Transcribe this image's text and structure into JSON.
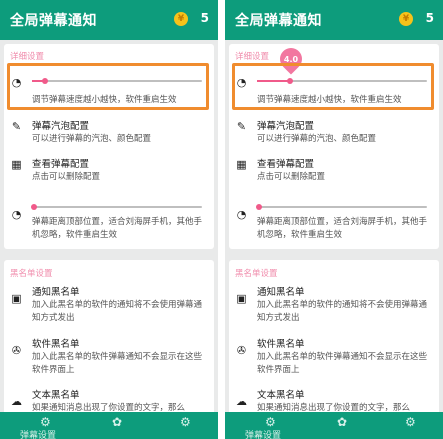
{
  "left": {
    "title": "全局弹幕通知",
    "coin_count": "5",
    "section_detail": "详细设置",
    "speed_desc": "调节弹幕速度越小越快，软件重启生效",
    "bubble_title": "弹幕汽泡配置",
    "bubble_desc": "可以进行弹幕的汽泡、颜色配置",
    "view_title": "查看弹幕配置",
    "view_desc": "点击可以删除配置",
    "offset_desc": "弹幕距离顶部位置，适合刘海屏手机，其他手机忽略，软件重启生效",
    "section_blacklist": "黑名单设置",
    "notify_title": "通知黑名单",
    "notify_desc": "加入此黑名单的软件的通知将不会使用弹幕通知方式发出",
    "soft_title": "软件黑名单",
    "soft_desc": "加入此黑名单的软件弹幕通知不会显示在这些软件界面上",
    "text_title": "文本黑名单",
    "text_desc": "如果通知消息出现了你设置的文字，那么",
    "nav_label": "弹幕设置"
  },
  "right": {
    "title": "全局弹幕通知",
    "coin_count": "5",
    "section_detail": "详细设置",
    "bubble_value": "4.0",
    "speed_desc": "调节弹幕速度越小越快，软件重启生效",
    "bubble_title": "弹幕汽泡配置",
    "bubble_desc": "可以进行弹幕的汽泡、颜色配置",
    "view_title": "查看弹幕配置",
    "view_desc": "点击可以删除配置",
    "offset_desc": "弹幕距离顶部位置，适合刘海屏手机，其他手机忽略，软件重启生效",
    "section_blacklist": "黑名单设置",
    "notify_title": "通知黑名单",
    "notify_desc": "加入此黑名单的软件的通知将不会使用弹幕通知方式发出",
    "soft_title": "软件黑名单",
    "soft_desc": "加入此黑名单的软件弹幕通知不会显示在这些软件界面上",
    "text_title": "文本黑名单",
    "text_desc": "如果通知消息出现了你设置的文字，那么",
    "nav_label": "弹幕设置"
  },
  "colors": {
    "primary": "#0d9c7c",
    "accent": "#f05a8a",
    "highlight": "#f08c2e"
  },
  "icons": [
    "gauge-icon",
    "bubble-config-icon",
    "view-config-icon",
    "position-icon",
    "notify-blacklist-icon",
    "soft-blacklist-icon",
    "text-blacklist-icon",
    "coin-icon",
    "settings-icon",
    "gear-icon"
  ]
}
